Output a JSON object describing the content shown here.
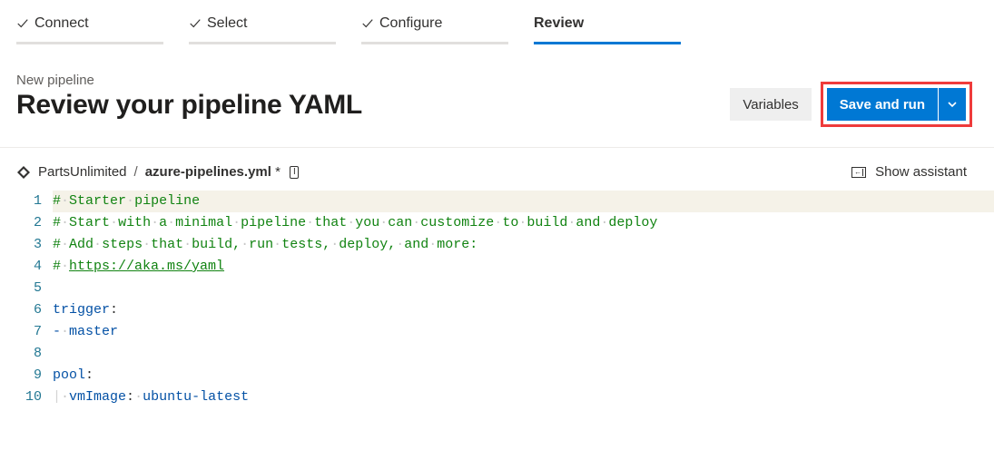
{
  "wizard": {
    "steps": [
      {
        "label": "Connect",
        "done": true,
        "active": false
      },
      {
        "label": "Select",
        "done": true,
        "active": false
      },
      {
        "label": "Configure",
        "done": true,
        "active": false
      },
      {
        "label": "Review",
        "done": false,
        "active": true
      }
    ]
  },
  "header": {
    "subtitle": "New pipeline",
    "title": "Review your pipeline YAML",
    "variables_label": "Variables",
    "save_label": "Save and run"
  },
  "breadcrumb": {
    "repo": "PartsUnlimited",
    "sep": "/",
    "filename": "azure-pipelines.yml",
    "modified": "*"
  },
  "assistant_label": "Show assistant",
  "editor": {
    "lines": [
      {
        "n": 1,
        "type": "comment",
        "tokens": [
          "#",
          " ",
          "Starter",
          " ",
          "pipeline"
        ]
      },
      {
        "n": 2,
        "type": "comment",
        "tokens": [
          "#",
          " ",
          "Start",
          " ",
          "with",
          " ",
          "a",
          " ",
          "minimal",
          " ",
          "pipeline",
          " ",
          "that",
          " ",
          "you",
          " ",
          "can",
          " ",
          "customize",
          " ",
          "to",
          " ",
          "build",
          " ",
          "and",
          " ",
          "deploy"
        ]
      },
      {
        "n": 3,
        "type": "comment",
        "tokens": [
          "#",
          " ",
          "Add",
          " ",
          "steps",
          " ",
          "that",
          " ",
          "build,",
          " ",
          "run",
          " ",
          "tests,",
          " ",
          "deploy,",
          " ",
          "and",
          " ",
          "more:"
        ]
      },
      {
        "n": 4,
        "type": "comment-link",
        "prefix": [
          "#",
          " "
        ],
        "link": "https://aka.ms/yaml"
      },
      {
        "n": 5,
        "type": "blank"
      },
      {
        "n": 6,
        "type": "kv",
        "key": "trigger",
        "colon": ":"
      },
      {
        "n": 7,
        "type": "list-item",
        "dash": "-",
        "value": "master"
      },
      {
        "n": 8,
        "type": "blank"
      },
      {
        "n": 9,
        "type": "kv",
        "key": "pool",
        "colon": ":"
      },
      {
        "n": 10,
        "type": "kv-indent",
        "indent": 1,
        "key": "vmImage",
        "colon": ":",
        "value": "ubuntu-latest"
      }
    ]
  }
}
